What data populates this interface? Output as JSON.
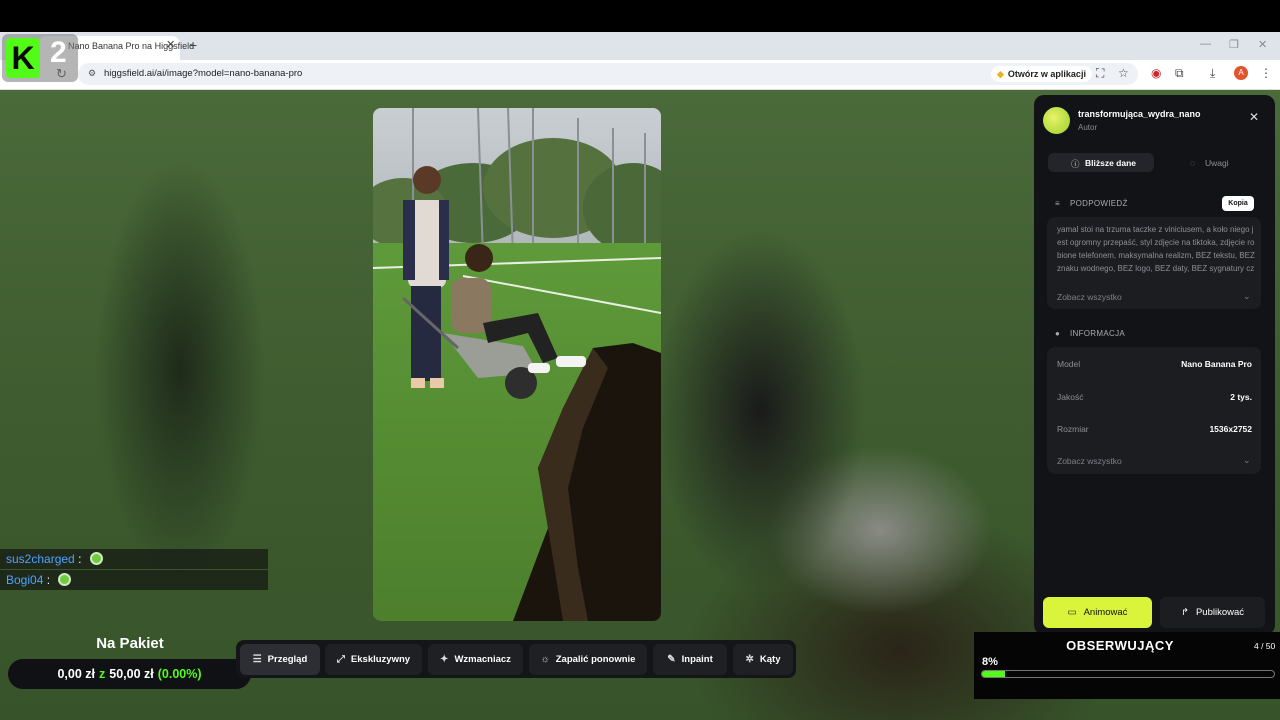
{
  "browser": {
    "tab_title": "Nano Banana Pro na Higgsfield",
    "url": "higgsfield.ai/ai/image?model=nano-banana-pro",
    "open_in_app": "Otwórz w aplikacji",
    "profile_initial": "A"
  },
  "overlay": {
    "kick_number": "2"
  },
  "panel": {
    "author_name": "transformująca_wydra_nano",
    "author_role": "Autor",
    "tabs": [
      {
        "label": "Bliższe dane",
        "active": true
      },
      {
        "label": "Uwagi",
        "active": false
      }
    ],
    "prompt": {
      "title": "PODPOWIEDŹ",
      "copy_label": "Kopia",
      "text": "yamal stoi na trzuma taczke z viniciusem, a koło niego jest ogromny przepaść, styl zdjęcie na tiktoka, zdjęcie robione telefonem, maksymalna realizm, BEZ tekstu, BEZ znaku wodnego, BEZ logo, BEZ daty, BEZ sygnatury czasowej, BEZ interfejsu",
      "see_all": "Zobacz wszystko"
    },
    "info": {
      "title": "INFORMACJA",
      "rows": [
        {
          "label": "Model",
          "value": "Nano Banana Pro"
        },
        {
          "label": "Jakość",
          "value": "2 tys."
        },
        {
          "label": "Rozmiar",
          "value": "1536x2752"
        }
      ],
      "see_all": "Zobacz wszystko"
    },
    "animate_label": "Animować",
    "publish_label": "Publikować"
  },
  "chat": [
    {
      "user": "sus2charged",
      "sep": ":"
    },
    {
      "user": "Bogi04",
      "sep": ":"
    }
  ],
  "package": {
    "title": "Na Pakiet",
    "current": "0,00 zł",
    "of": "z",
    "target": "50,00 zł",
    "percent": "(0.00%)"
  },
  "toolbar": [
    {
      "label": "Przegląd",
      "icon": "lines-icon",
      "active": true
    },
    {
      "label": "Ekskluzywny",
      "icon": "expand-icon",
      "active": false
    },
    {
      "label": "Wzmacniacz",
      "icon": "wand-icon",
      "active": false
    },
    {
      "label": "Zapalić ponownie",
      "icon": "relight-icon",
      "active": false
    },
    {
      "label": "Inpaint",
      "icon": "brush-icon",
      "active": false
    },
    {
      "label": "Kąty",
      "icon": "angles-icon",
      "active": false
    }
  ],
  "goal": {
    "title": "OBSERWUJĄCY",
    "count": "4 / 50",
    "percent_label": "8%",
    "progress": 0.08
  },
  "colors": {
    "accent": "#d9f43a",
    "kick_green": "#53fc18",
    "panel_bg": "#121316"
  }
}
